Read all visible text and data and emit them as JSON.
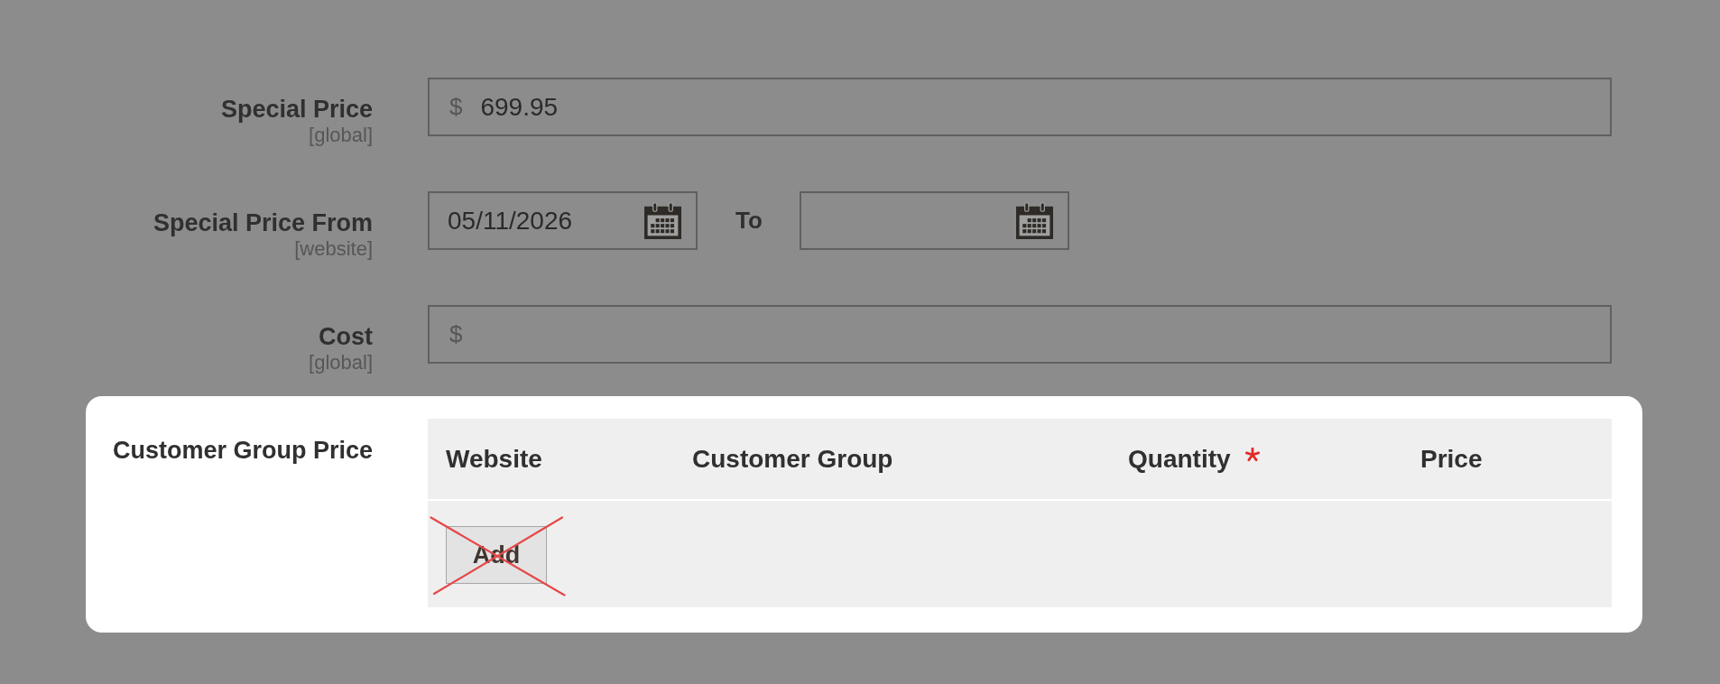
{
  "fields": [
    {
      "kind": "currency",
      "label": "Special Price",
      "scope": "[global]",
      "prefix": "$",
      "value": "699.95"
    },
    {
      "kind": "date_range",
      "label": "Special Price From",
      "scope": "[website]",
      "from": {
        "value": "05/11/2026"
      },
      "to": {
        "label": "To"
      }
    },
    {
      "kind": "currency",
      "label": "Cost",
      "scope": "[global]",
      "prefix": "$"
    }
  ],
  "customer_group_price": {
    "label": "Customer Group Price",
    "highlighted": true,
    "columns": [
      {
        "label": "Website",
        "required": false
      },
      {
        "label": "Customer Group",
        "required": false
      },
      {
        "label": "Quantity",
        "required": true
      },
      {
        "label": "Price",
        "required": false
      }
    ],
    "add_button": {
      "label": "Add",
      "crossed_out": true
    }
  }
}
